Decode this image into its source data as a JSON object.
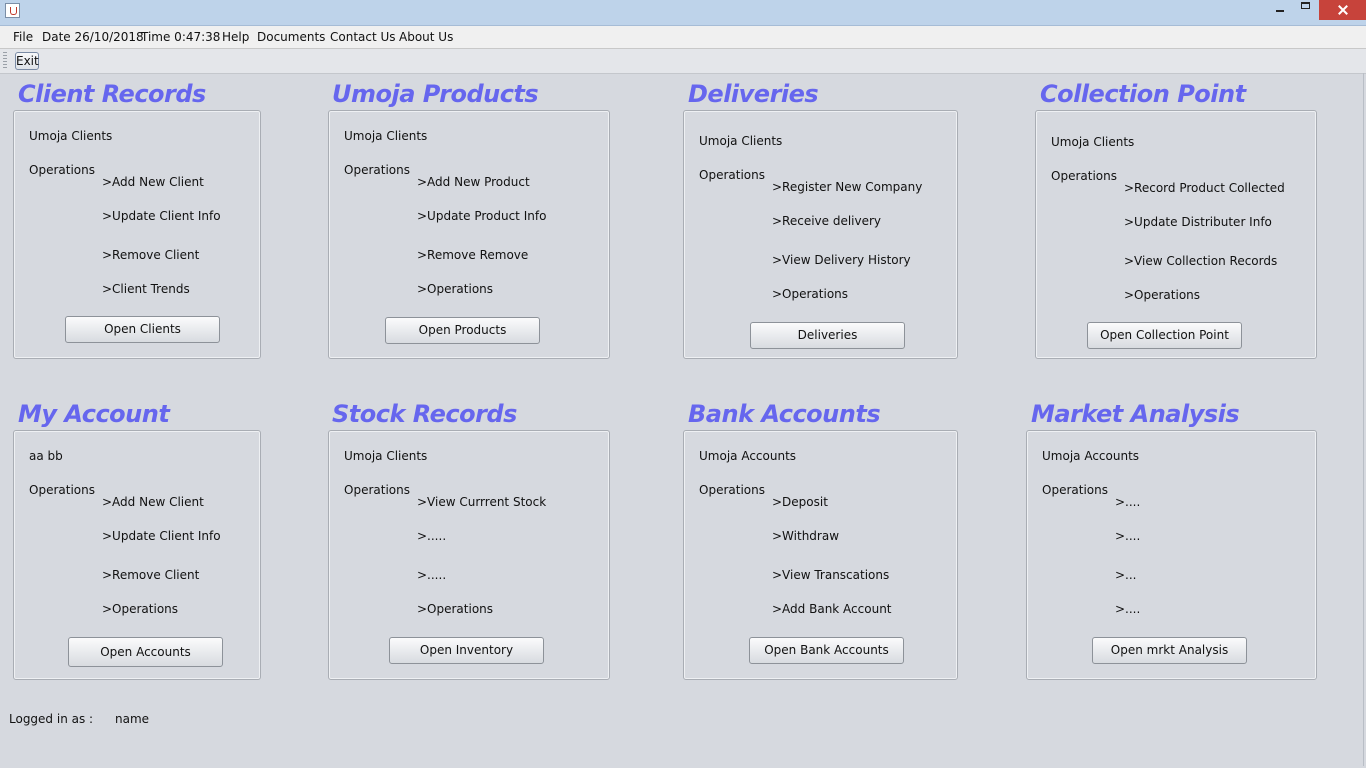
{
  "window": {
    "title": ""
  },
  "menu": {
    "file": "File",
    "date": "Date 26/10/2018",
    "time": "Time 0:47:38",
    "help": "Help",
    "documents": "Documents",
    "contact": "Contact Us",
    "about": "About Us"
  },
  "toolbar": {
    "exit_label": "Exit"
  },
  "sections": [
    {
      "title": "Client Records",
      "header": "Umoja Clients",
      "ops_label": "Operations",
      "items": [
        ">Add New Client",
        ">Update Client Info",
        ">Remove Client",
        ">Client Trends"
      ],
      "button": "Open Clients"
    },
    {
      "title": "Umoja Products",
      "header": "Umoja Clients",
      "ops_label": "Operations",
      "items": [
        ">Add New Product",
        ">Update Product Info",
        ">Remove Remove",
        ">Operations"
      ],
      "button": "Open Products"
    },
    {
      "title": "Deliveries",
      "header": "Umoja Clients",
      "ops_label": "Operations",
      "items": [
        ">Register New Company",
        ">Receive delivery",
        ">View Delivery History",
        ">Operations"
      ],
      "button": "Deliveries"
    },
    {
      "title": "Collection Point",
      "header": "Umoja Clients",
      "ops_label": "Operations",
      "items": [
        ">Record Product Collected",
        ">Update Distributer Info",
        ">View Collection Records",
        ">Operations"
      ],
      "button": "Open Collection Point"
    },
    {
      "title": "My Account",
      "header": "aa bb",
      "ops_label": "Operations",
      "items": [
        ">Add New Client",
        ">Update Client Info",
        ">Remove Client",
        ">Operations"
      ],
      "button": "Open Accounts"
    },
    {
      "title": "Stock Records",
      "header": "Umoja Clients",
      "ops_label": "Operations",
      "items": [
        ">View Currrent Stock",
        ">.....",
        ">.....",
        ">Operations"
      ],
      "button": "Open Inventory"
    },
    {
      "title": "Bank Accounts",
      "header": "Umoja Accounts",
      "ops_label": "Operations",
      "items": [
        ">Deposit",
        ">Withdraw",
        ">View Transcations",
        ">Add Bank Account"
      ],
      "button": "Open Bank Accounts"
    },
    {
      "title": "Market Analysis",
      "header": "Umoja Accounts",
      "ops_label": "Operations",
      "items": [
        ">....",
        ">....",
        ">...",
        ">...."
      ],
      "button": "Open mrkt Analysis"
    }
  ],
  "status": {
    "label": "Logged in as :",
    "user": "name"
  },
  "colors": {
    "title": "#6666ee",
    "background": "#d6d9df",
    "close": "#c7433b"
  }
}
